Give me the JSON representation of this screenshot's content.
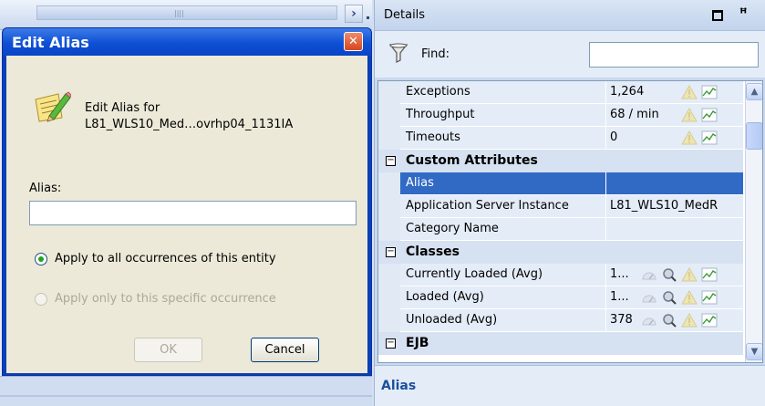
{
  "dialog": {
    "title": "Edit Alias",
    "heading_line1": "Edit Alias for",
    "heading_line2": "L81_WLS10_Med…ovrhp04_1131IA",
    "alias_label": "Alias:",
    "alias_value": "",
    "radio_all_label": "Apply to all occurrences of this entity",
    "radio_all_checked": true,
    "radio_specific_label": "Apply only to this specific occurrence",
    "radio_specific_enabled": false,
    "ok_label": "OK",
    "ok_enabled": false,
    "cancel_label": "Cancel"
  },
  "details": {
    "title": "Details",
    "find_label": "Find:",
    "find_value": "",
    "description_title": "Alias",
    "rows": [
      {
        "kind": "row",
        "name": "Exceptions",
        "value": "1,264",
        "icons": [
          "warning-icon",
          "chart-icon"
        ]
      },
      {
        "kind": "row",
        "name": "Throughput",
        "value": "68 / min",
        "icons": [
          "warning-icon",
          "chart-icon"
        ]
      },
      {
        "kind": "row",
        "name": "Timeouts",
        "value": "0",
        "icons": [
          "warning-icon",
          "chart-icon"
        ]
      },
      {
        "kind": "section",
        "name": "Custom Attributes"
      },
      {
        "kind": "row",
        "name": "Alias",
        "value": "",
        "selected": true,
        "icons": []
      },
      {
        "kind": "row",
        "name": "Application Server Instance",
        "value": "L81_WLS10_MedR",
        "icons": []
      },
      {
        "kind": "row",
        "name": "Category Name",
        "value": "",
        "icons": []
      },
      {
        "kind": "section",
        "name": "Classes"
      },
      {
        "kind": "row",
        "name": "Currently Loaded (Avg)",
        "value": "1...",
        "icons": [
          "gauge-icon",
          "magnifier-icon",
          "warning-icon",
          "chart-icon"
        ]
      },
      {
        "kind": "row",
        "name": "Loaded (Avg)",
        "value": "1...",
        "icons": [
          "gauge-icon",
          "magnifier-icon",
          "warning-icon",
          "chart-icon"
        ]
      },
      {
        "kind": "row",
        "name": "Unloaded (Avg)",
        "value": "378",
        "icons": [
          "gauge-icon",
          "magnifier-icon",
          "warning-icon",
          "chart-icon"
        ]
      },
      {
        "kind": "section",
        "name": "EJB"
      }
    ]
  },
  "colors": {
    "selection": "#316ac5",
    "dialog_title": "#0e4fd4",
    "panel": "#e4ecf7"
  }
}
